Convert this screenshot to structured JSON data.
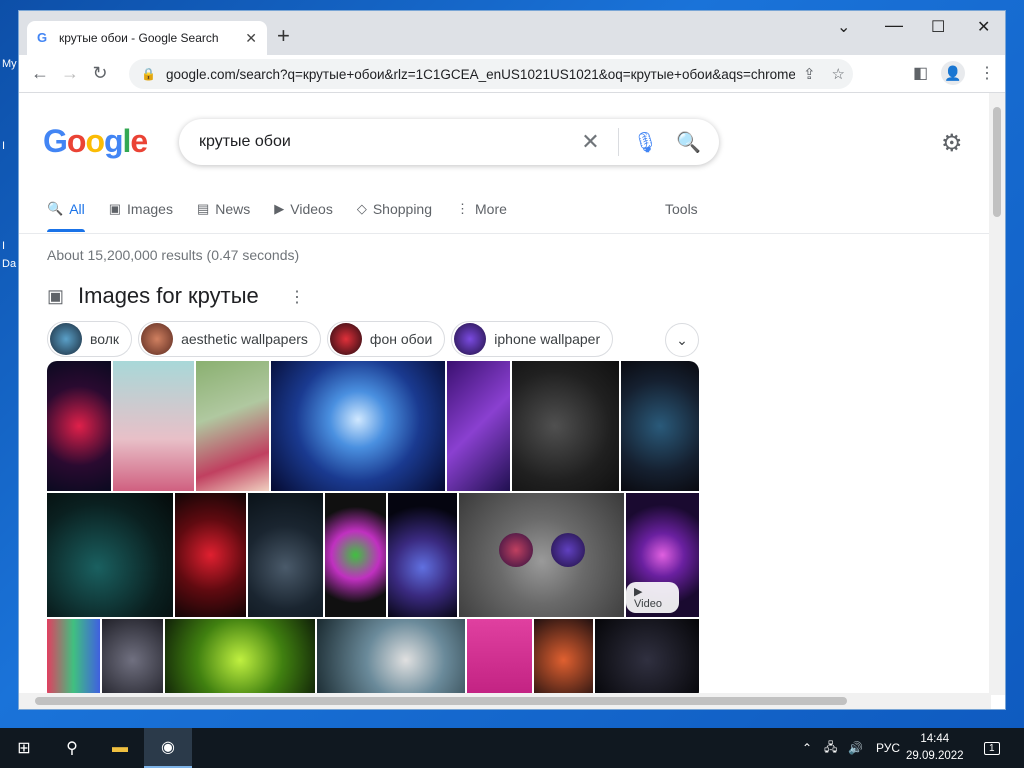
{
  "desktop": {
    "labels": [
      "My",
      "I",
      "I",
      "Da"
    ]
  },
  "browser": {
    "tab_title": "крутые обои - Google Search",
    "new_tab": "+",
    "url": "google.com/search?q=крутые+обои&rlz=1C1GCEA_enUS1021US1021&oq=крутые+обои&aqs=chrome....",
    "controls": {
      "minimize": "⌄",
      "maximize": "☐",
      "close": "✕"
    }
  },
  "google": {
    "logo": [
      "G",
      "o",
      "o",
      "g",
      "l",
      "e"
    ],
    "logo_colors": [
      "#4285F4",
      "#EA4335",
      "#FBBC05",
      "#4285F4",
      "#34A853",
      "#EA4335"
    ],
    "query": "крутые обои",
    "tabs": [
      {
        "label": "All",
        "icon": "🔍"
      },
      {
        "label": "Images",
        "icon": "▣"
      },
      {
        "label": "News",
        "icon": "▤"
      },
      {
        "label": "Videos",
        "icon": "▶"
      },
      {
        "label": "Shopping",
        "icon": "◇"
      },
      {
        "label": "More",
        "icon": "⋮"
      }
    ],
    "tools": "Tools",
    "stats": "About 15,200,000 results (0.47 seconds)",
    "images_title": "Images for крутые",
    "chips": [
      {
        "label": "волк",
        "color": "#2a4a66"
      },
      {
        "label": "aesthetic wallpapers",
        "color": "#8a4a3a"
      },
      {
        "label": "фон обои",
        "color": "#6a1a2a"
      },
      {
        "label": "iphone wallpaper",
        "color": "#4a2a8a"
      }
    ],
    "video_badge": "▶ Video"
  },
  "taskbar": {
    "language": "РУС",
    "time": "14:44",
    "date": "29.09.2022",
    "notification_count": "1"
  }
}
